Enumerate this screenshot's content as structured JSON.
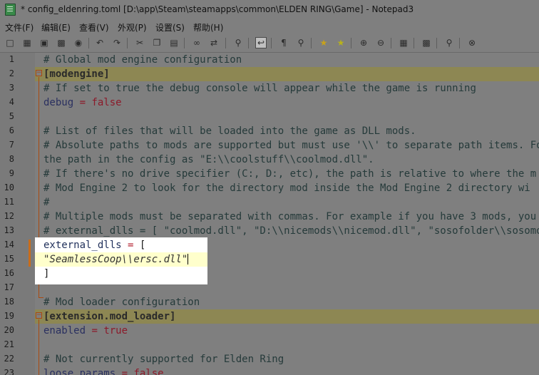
{
  "window": {
    "title": "* config_eldenring.toml [D:\\app\\Steam\\steamapps\\common\\ELDEN RING\\Game] - Notepad3"
  },
  "menu": [
    {
      "label": "文件(F)"
    },
    {
      "label": "编辑(E)"
    },
    {
      "label": "查看(V)"
    },
    {
      "label": "外观(P)"
    },
    {
      "label": "设置(S)"
    },
    {
      "label": "帮助(H)"
    }
  ],
  "toolbar": {
    "icons": [
      "new-file-icon",
      "open-file-icon",
      "save-icon",
      "save-as-icon",
      "browse-icon",
      "undo-icon",
      "redo-icon",
      "cut-icon",
      "copy-icon",
      "paste-icon",
      "find-icon",
      "replace-icon",
      "goto-icon",
      "word-wrap-icon",
      "view-whitespace-icon",
      "zoom-icon",
      "add-favorite-icon",
      "favorites-icon",
      "zoom-in-icon",
      "zoom-out-icon",
      "schema-icon",
      "customize-schemes-icon",
      "pin-icon",
      "exit-icon"
    ]
  },
  "editor": {
    "lines": [
      {
        "num": "1",
        "text": "# Global mod engine configuration"
      },
      {
        "num": "2",
        "text": "[modengine]"
      },
      {
        "num": "3",
        "text": "# If set to true the debug console will appear while the game is running"
      },
      {
        "num": "4",
        "key": "debug",
        "op": " = ",
        "value": "false"
      },
      {
        "num": "5",
        "text": ""
      },
      {
        "num": "6",
        "text": "# List of files that will be loaded into the game as DLL mods."
      },
      {
        "num": "7",
        "text": "# Absolute paths to mods are supported but must use '\\\\' to separate path items. Fo"
      },
      {
        "num": "8",
        "text": "the path in the config as \"E:\\\\coolstuff\\\\coolmod.dll\"."
      },
      {
        "num": "9",
        "text": "# If there's no drive specifier (C:, D:, etc), the path is relative to where the m"
      },
      {
        "num": "10",
        "text": "# Mod Engine 2 to look for the directory mod inside the Mod Engine 2 directory wi"
      },
      {
        "num": "11",
        "text": "#"
      },
      {
        "num": "12",
        "text": "# Multiple mods must be separated with commas. For example if you have 3 mods, you"
      },
      {
        "num": "13",
        "text": "# external_dlls = [ \"coolmod.dll\", \"D:\\\\nicemods\\\\nicemod.dll\", \"sosofolder\\\\sosomod"
      },
      {
        "num": "14",
        "key": "external_dlls",
        "op": " = ",
        "value": "["
      },
      {
        "num": "15",
        "text": "\"SeamlessCoop\\\\ersc.dll\""
      },
      {
        "num": "16",
        "text": "]"
      },
      {
        "num": "17",
        "text": ""
      },
      {
        "num": "18",
        "text": "# Mod loader configuration"
      },
      {
        "num": "19",
        "text": "[extension.mod_loader]"
      },
      {
        "num": "20",
        "key": "enabled",
        "op": " = ",
        "value": "true"
      },
      {
        "num": "21",
        "text": ""
      },
      {
        "num": "22",
        "text": "# Not currently supported for Elden Ring"
      },
      {
        "num": "23",
        "key": "loose_params",
        "op": " = ",
        "value": "false"
      }
    ]
  }
}
